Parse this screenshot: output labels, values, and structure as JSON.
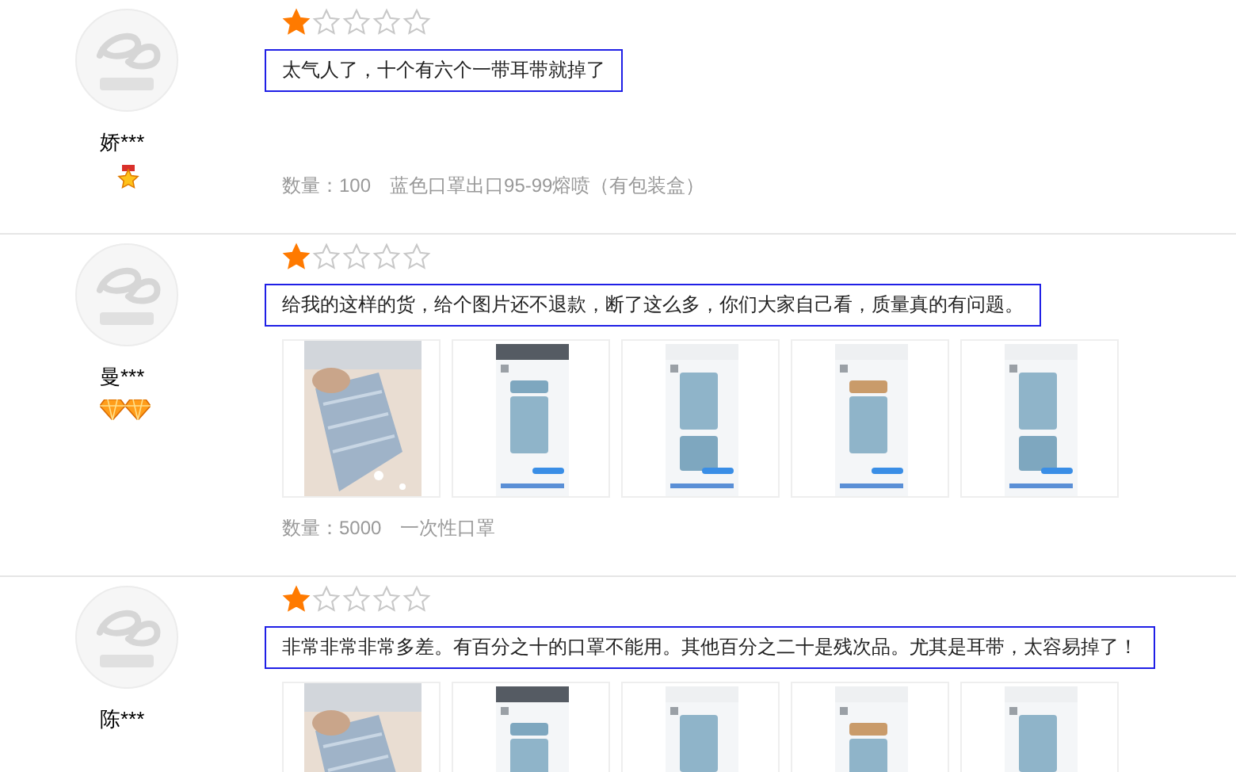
{
  "reviews": [
    {
      "user": "娇***",
      "badges": [
        {
          "kind": "medal"
        }
      ],
      "stars": 1,
      "comment": "太气人了，十个有六个一带耳带就掉了",
      "quantity": "数量：100",
      "product": "蓝色口罩出口95-99熔喷（有包装盒）"
    },
    {
      "user": "曼***",
      "badges": [
        {
          "kind": "diamond"
        },
        {
          "kind": "diamond"
        }
      ],
      "stars": 1,
      "comment": "给我的这样的货，给个图片还不退款，断了这么多，你们大家自己看，质量真的有问题。",
      "images": [
        {
          "kind": "picture"
        },
        {
          "kind": "picture"
        },
        {
          "kind": "picture"
        },
        {
          "kind": "picture"
        },
        {
          "kind": "picture"
        }
      ],
      "quantity": "数量：5000",
      "product": "一次性口罩"
    },
    {
      "user": "陈***",
      "stars": 1,
      "comment": "非常非常非常多差。有百分之十的口罩不能用。其他百分之二十是残次品。尤其是耳带，太容易掉了！",
      "images": [
        {
          "kind": "picture"
        },
        {
          "kind": "picture"
        },
        {
          "kind": "picture"
        },
        {
          "kind": "picture"
        },
        {
          "kind": "picture"
        }
      ]
    }
  ]
}
